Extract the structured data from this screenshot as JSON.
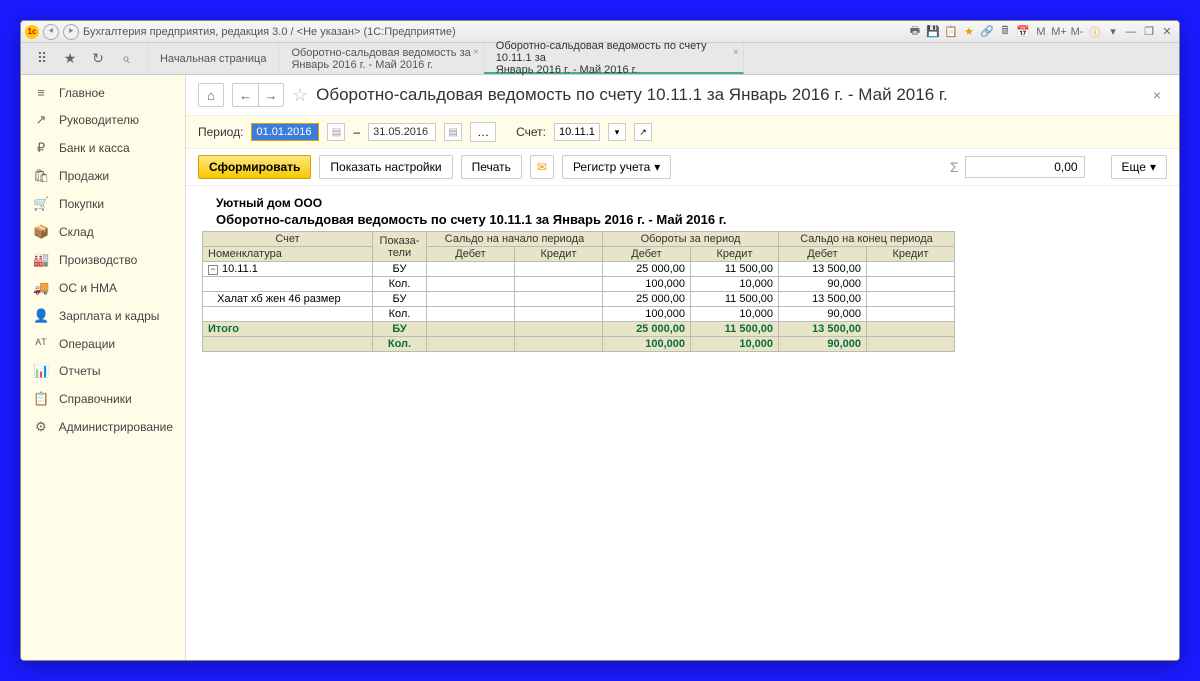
{
  "titlebar": {
    "app_title": "Бухгалтерия предприятия, редакция 3.0 / <Не указан>  (1С:Предприятие)",
    "m_buttons": [
      "М",
      "М+",
      "М-"
    ]
  },
  "tabs": [
    {
      "line1": "Начальная страница",
      "line2": ""
    },
    {
      "line1": "Оборотно-сальдовая ведомость за",
      "line2": "Январь 2016 г. - Май 2016 г."
    },
    {
      "line1": "Оборотно-сальдовая ведомость по счету 10.11.1 за",
      "line2": "Январь 2016 г. - Май 2016 г."
    }
  ],
  "sidebar": [
    {
      "icon": "≡",
      "label": "Главное"
    },
    {
      "icon": "↗",
      "label": "Руководителю"
    },
    {
      "icon": "₽",
      "label": "Банк и касса"
    },
    {
      "icon": "🛍",
      "label": "Продажи"
    },
    {
      "icon": "🛒",
      "label": "Покупки"
    },
    {
      "icon": "📦",
      "label": "Склад"
    },
    {
      "icon": "🏭",
      "label": "Производство"
    },
    {
      "icon": "🚚",
      "label": "ОС и НМА"
    },
    {
      "icon": "👤",
      "label": "Зарплата и кадры"
    },
    {
      "icon": "ᴬᵀ",
      "label": "Операции"
    },
    {
      "icon": "📊",
      "label": "Отчеты"
    },
    {
      "icon": "📋",
      "label": "Справочники"
    },
    {
      "icon": "⚙",
      "label": "Администрирование"
    }
  ],
  "page": {
    "title": "Оборотно-сальдовая ведомость по счету 10.11.1 за Январь 2016 г. - Май 2016 г."
  },
  "params": {
    "period_label": "Период:",
    "date_from": "01.01.2016",
    "date_to": "31.05.2016",
    "dash": "–",
    "account_label": "Счет:",
    "account_value": "10.11.1"
  },
  "toolbar": {
    "generate": "Сформировать",
    "settings": "Показать настройки",
    "print": "Печать",
    "register": "Регистр учета",
    "sum_value": "0,00",
    "more": "Еще"
  },
  "report": {
    "org": "Уютный дом ООО",
    "title": "Оборотно-сальдовая ведомость по счету 10.11.1 за Январь 2016 г. - Май 2016 г.",
    "headers": {
      "account": "Счет",
      "nomenclature": "Номенклатура",
      "indicators": "Показа-\nтели",
      "saldo_start": "Сальдо на начало периода",
      "turnover": "Обороты за период",
      "saldo_end": "Сальдо на конец периода",
      "debit": "Дебет",
      "credit": "Кредит"
    },
    "rows": [
      {
        "name": "10.11.1",
        "ind": "БУ",
        "t_d": "25 000,00",
        "t_c": "11 500,00",
        "e_d": "13 500,00"
      },
      {
        "name": "",
        "ind": "Кол.",
        "t_d": "100,000",
        "t_c": "10,000",
        "e_d": "90,000"
      },
      {
        "name": "Халат хб жен 46 размер",
        "ind": "БУ",
        "t_d": "25 000,00",
        "t_c": "11 500,00",
        "e_d": "13 500,00",
        "indent": true
      },
      {
        "name": "",
        "ind": "Кол.",
        "t_d": "100,000",
        "t_c": "10,000",
        "e_d": "90,000"
      }
    ],
    "total": {
      "label": "Итого",
      "rows": [
        {
          "ind": "БУ",
          "t_d": "25 000,00",
          "t_c": "11 500,00",
          "e_d": "13 500,00"
        },
        {
          "ind": "Кол.",
          "t_d": "100,000",
          "t_c": "10,000",
          "e_d": "90,000"
        }
      ]
    }
  }
}
